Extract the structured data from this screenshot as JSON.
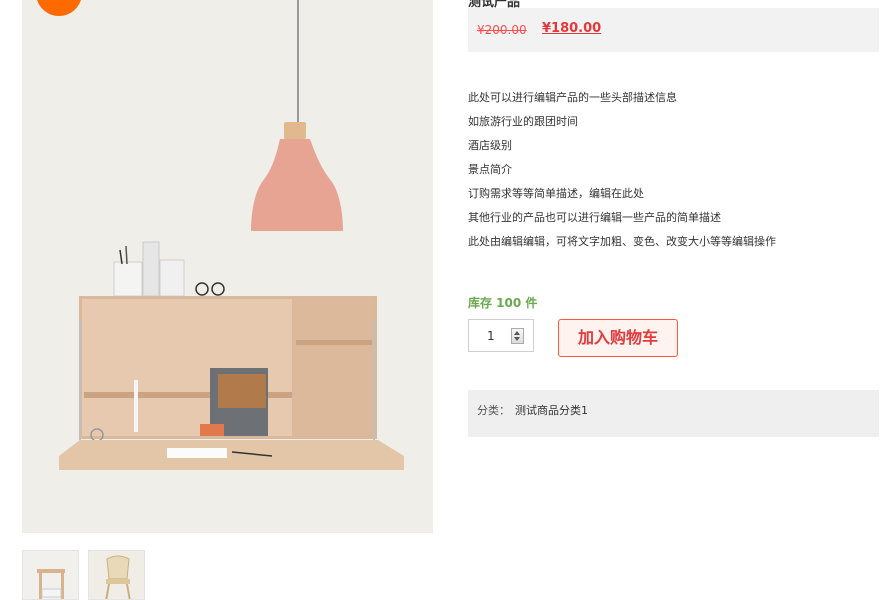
{
  "product": {
    "title": "测试产品",
    "old_price": "¥200.00",
    "new_price": "¥180.00",
    "description": [
      "此处可以进行编辑产品的一些头部描述信息",
      "如旅游行业的跟团时间",
      "酒店级别",
      "景点简介",
      "订购需求等等简单描述，编辑在此处",
      "其他行业的产品也可以进行编辑一些产品的简单描述",
      "此处由编辑编辑，可将文字加粗、变色、改变大小等等编辑操作"
    ],
    "stock": "库存 100 件",
    "quantity": "1",
    "add_to_cart_label": "加入购物车",
    "category_label": "分类：",
    "category_value": "测试商品分类1"
  },
  "colors": {
    "price_red": "#e4393c",
    "stock_green": "#6aa84f",
    "badge_orange": "#ff6a00"
  },
  "images": {
    "main": "pendant-lamp-and-wall-desk-photo",
    "thumbnails": [
      "wooden-side-table-thumb",
      "chair-thumb"
    ]
  }
}
